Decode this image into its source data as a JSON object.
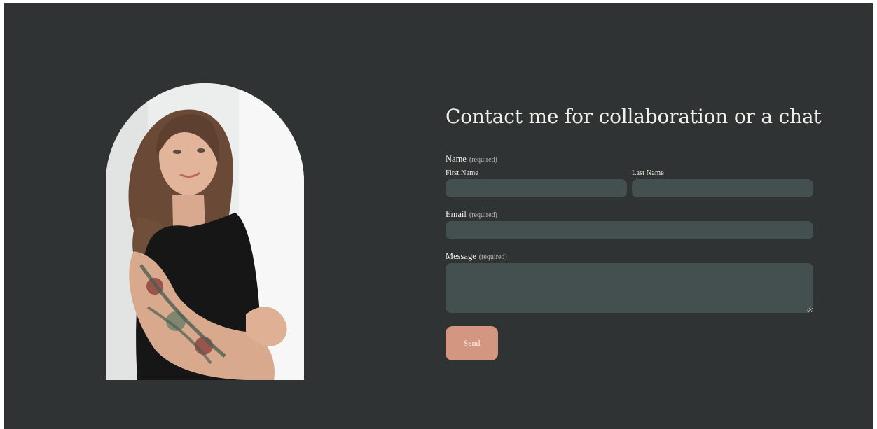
{
  "contact": {
    "title": "Contact me for collaboration or a chat",
    "name_field": {
      "label": "Name",
      "required": "(required)",
      "first_label": "First Name",
      "first_value": "",
      "last_label": "Last Name",
      "last_value": ""
    },
    "email_field": {
      "label": "Email",
      "required": "(required)",
      "value": ""
    },
    "message_field": {
      "label": "Message",
      "required": "(required)",
      "value": ""
    },
    "send_label": "Send"
  },
  "colors": {
    "background": "#2f3333",
    "input_fill": "#445050",
    "accent": "#d39680",
    "text": "#f1efe9"
  }
}
